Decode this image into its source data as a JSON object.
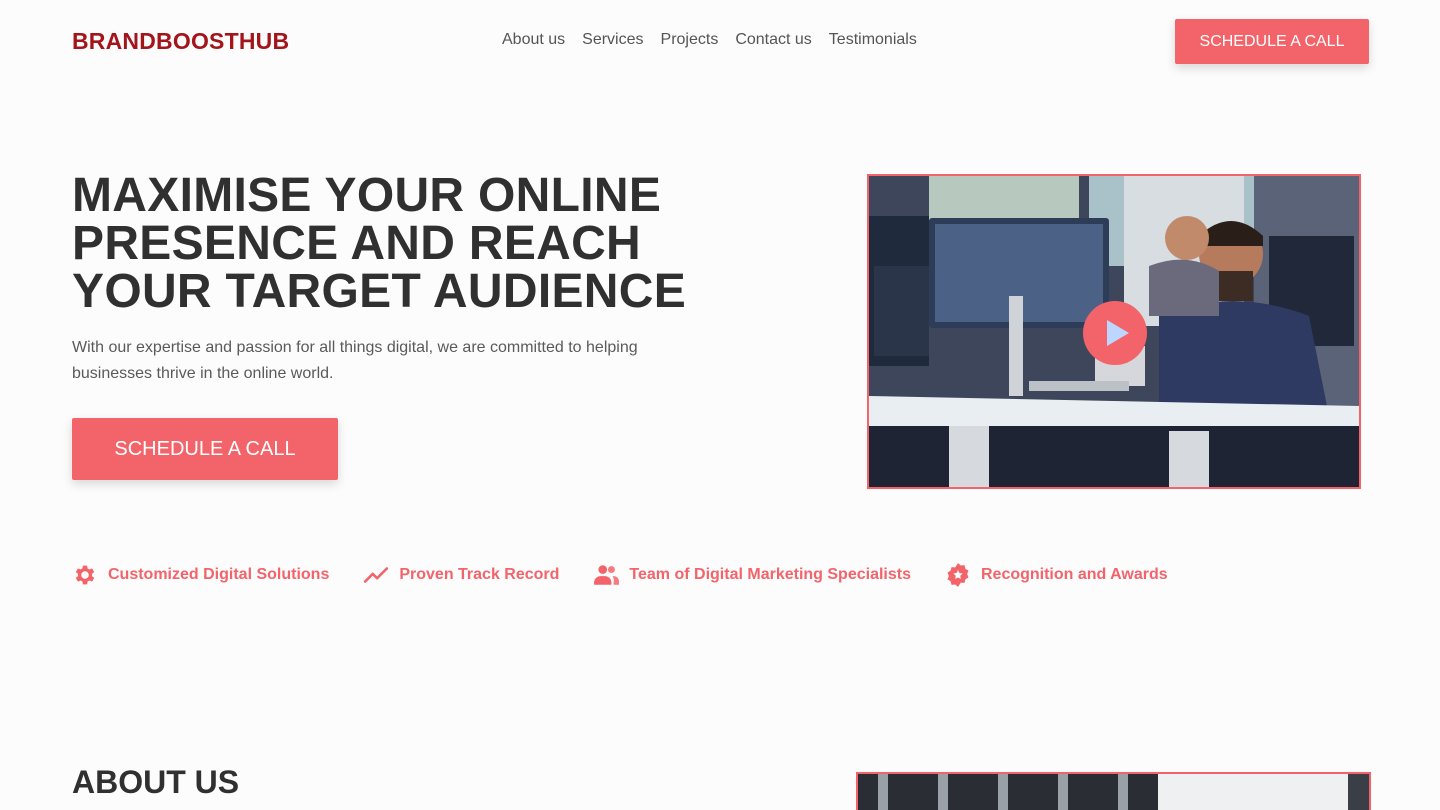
{
  "header": {
    "logo": "BRANDBOOSTHUB",
    "nav": [
      "About us",
      "Services",
      "Projects",
      "Contact us",
      "Testimonials"
    ],
    "cta_label": "SCHEDULE A CALL"
  },
  "hero": {
    "title_lines": [
      "MAXIMISE YOUR ONLINE",
      "PRESENCE AND REACH",
      "YOUR TARGET AUDIENCE"
    ],
    "subtitle": "With our expertise and passion for all things digital, we are committed to helping businesses thrive in the online world.",
    "cta_label": "SCHEDULE A CALL",
    "video_icon": "play-icon"
  },
  "features": [
    {
      "icon": "gear-icon",
      "label": "Customized Digital Solutions"
    },
    {
      "icon": "trend-up-icon",
      "label": "Proven Track Record"
    },
    {
      "icon": "users-icon",
      "label": "Team of Digital Marketing Specialists"
    },
    {
      "icon": "award-badge-icon",
      "label": "Recognition and Awards"
    }
  ],
  "about": {
    "title": "ABOUT US"
  },
  "colors": {
    "accent": "#f2646a",
    "logo": "#a3151b",
    "heading": "#303030"
  }
}
